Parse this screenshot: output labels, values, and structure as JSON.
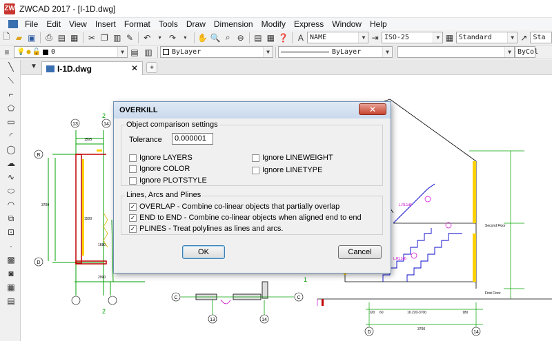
{
  "window": {
    "title": "ZWCAD 2017 - [I-1D.dwg]",
    "app_icon": "ZW"
  },
  "menu": [
    "File",
    "Edit",
    "View",
    "Insert",
    "Format",
    "Tools",
    "Draw",
    "Dimension",
    "Modify",
    "Express",
    "Window",
    "Help"
  ],
  "toolbar": {
    "text_style": "NAME",
    "dim_style": "ISO-25",
    "table_style": "Standard",
    "extra_style": "Sta"
  },
  "layers": {
    "layer_value": "0",
    "color": "ByLayer",
    "linetype": "ByLayer",
    "lineweight": "ByCol"
  },
  "doc_tab": {
    "label": "I-1D.dwg"
  },
  "dialog": {
    "title": "OVERKILL",
    "group_object": "Object comparison settings",
    "tolerance_label": "Tolerance",
    "tolerance_value": "0.000001",
    "ignore_layers": "Ignore LAYERS",
    "ignore_color": "Ignore COLOR",
    "ignore_plotstyle": "Ignore PLOTSTYLE",
    "ignore_lineweight": "Ignore LINEWEIGHT",
    "ignore_linetype": "Ignore LINETYPE",
    "group_lines": "Lines, Arcs and Plines",
    "overlap": "OVERLAP - Combine co-linear objects that partially overlap",
    "end_to_end": "END to END - Combine co-linear objects when aligned end to end",
    "plines": "PLINES - Treat polylines as lines and arcs.",
    "ok": "OK",
    "cancel": "Cancel"
  },
  "drawing": {
    "grid_labels": [
      "13",
      "14",
      "B",
      "D",
      "C",
      "C",
      "13",
      "14",
      "D",
      "14"
    ],
    "dims": [
      "1505",
      "1500",
      "3700",
      "2990",
      "1680",
      "3700",
      "10.220-3700",
      "120",
      "180",
      "60"
    ],
    "labels": [
      "2",
      "2",
      "1"
    ],
    "annotations": [
      "Second Floor",
      "First Floor",
      "L.RL1d6",
      "L.RL1d6"
    ]
  },
  "colors": {
    "accent": "#3a6fb0",
    "cad_green": "#00a000",
    "cad_magenta": "#d000d0",
    "cad_blue": "#0000cc"
  }
}
